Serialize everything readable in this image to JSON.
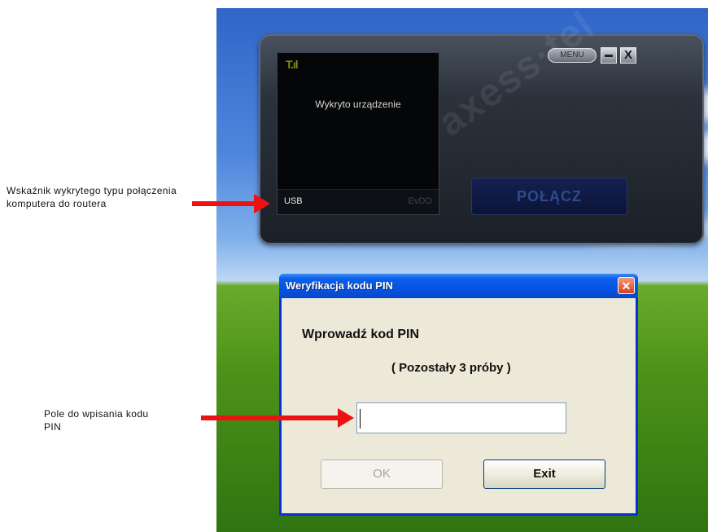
{
  "annotations": {
    "connection_indicator": "Wskaźnik wykrytego typu połączenia komputera do routera",
    "pin_field": "Pole do wpisania kodu PIN"
  },
  "widget": {
    "watermark": "axess·tel",
    "signal_icon": "signal-bars-icon",
    "status": "Wykryto urządzenie",
    "connection_type": "USB",
    "network_type": "EvDO",
    "menu_label": "MENU",
    "minimize_label": "",
    "close_label": "X",
    "connect_label": "POŁĄCZ"
  },
  "dialog": {
    "title": "Weryfikacja kodu PIN",
    "close_label": "✕",
    "prompt": "Wprowadź kod PIN",
    "tries": "( Pozostały 3 próby )",
    "pin_value": "",
    "ok_label": "OK",
    "exit_label": "Exit"
  },
  "colors": {
    "dialog_title_bar": "#0554e3",
    "annotation_arrow": "#ee1111",
    "connect_button": "#142050"
  }
}
